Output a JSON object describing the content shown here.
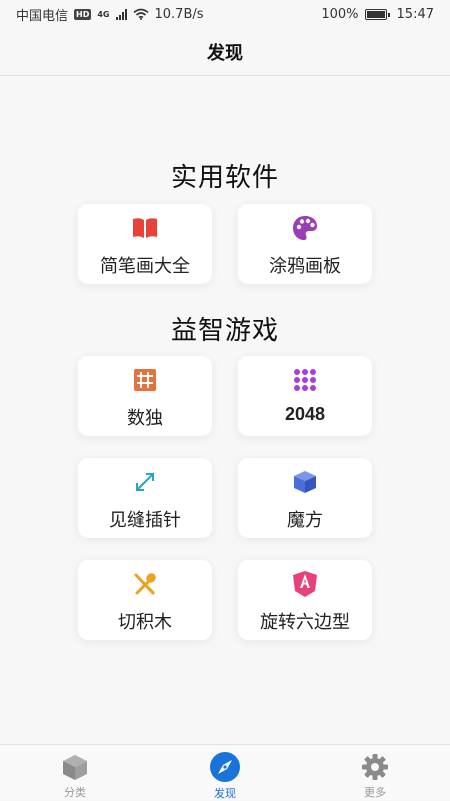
{
  "status_bar": {
    "carrier": "中国电信",
    "hd": "HD",
    "network": "4G",
    "speed": "10.7B/s",
    "battery": "100%",
    "time": "15:47"
  },
  "header": {
    "title": "发现"
  },
  "sections": [
    {
      "title": "实用软件",
      "items": [
        {
          "label": "简笔画大全",
          "icon": "book-icon",
          "color": "#e8403a"
        },
        {
          "label": "涂鸦画板",
          "icon": "palette-icon",
          "color": "#9b3db8"
        }
      ]
    },
    {
      "title": "益智游戏",
      "items": [
        {
          "label": "数独",
          "icon": "sudoku-grid-icon",
          "color": "#e8703a"
        },
        {
          "label": "2048",
          "icon": "dots-grid-icon",
          "color": "#a83ee0"
        },
        {
          "label": "见缝插针",
          "icon": "expand-arrows-icon",
          "color": "#2aa3c7"
        },
        {
          "label": "魔方",
          "icon": "cube-icon",
          "color": "#4a6fd8"
        },
        {
          "label": "切积木",
          "icon": "crossed-tools-icon",
          "color": "#f0a020"
        },
        {
          "label": "旋转六边型",
          "icon": "angular-shield-icon",
          "color": "#e8407a"
        }
      ]
    }
  ],
  "tabs": [
    {
      "label": "分类",
      "icon": "box-icon",
      "active": false
    },
    {
      "label": "发现",
      "icon": "compass-icon",
      "active": true
    },
    {
      "label": "更多",
      "icon": "gear-icon",
      "active": false
    }
  ],
  "colors": {
    "accent": "#1a73d9",
    "inactive": "#999999"
  }
}
